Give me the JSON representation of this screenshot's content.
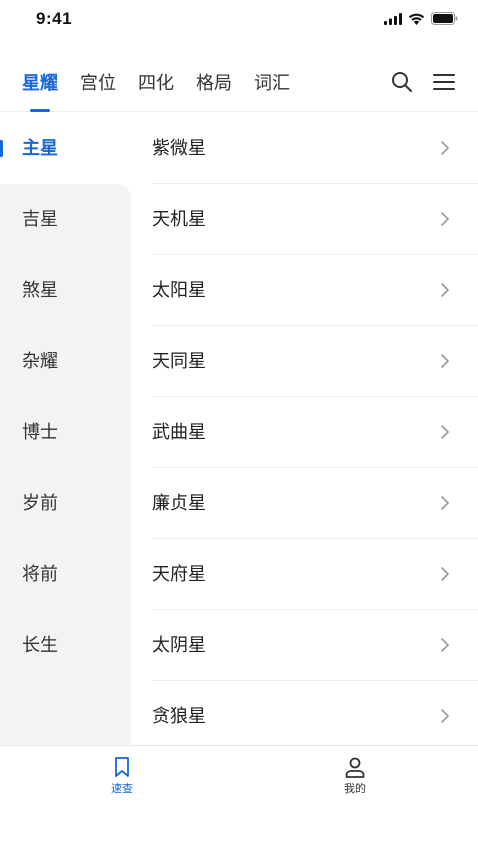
{
  "status_bar": {
    "time": "9:41",
    "icons": [
      "signal-icon",
      "wifi-icon",
      "battery-icon"
    ]
  },
  "top_nav": {
    "tabs": [
      {
        "label": "星耀",
        "active": true
      },
      {
        "label": "宫位",
        "active": false
      },
      {
        "label": "四化",
        "active": false
      },
      {
        "label": "格局",
        "active": false
      },
      {
        "label": "词汇",
        "active": false
      }
    ],
    "icons": [
      "search-icon",
      "menu-icon"
    ]
  },
  "sidebar": {
    "items": [
      {
        "label": "主星",
        "active": true
      },
      {
        "label": "吉星"
      },
      {
        "label": "煞星"
      },
      {
        "label": "杂耀"
      },
      {
        "label": "博士"
      },
      {
        "label": "岁前"
      },
      {
        "label": "将前"
      },
      {
        "label": "长生"
      }
    ]
  },
  "list": {
    "items": [
      {
        "label": "紫微星"
      },
      {
        "label": "天机星"
      },
      {
        "label": "太阳星"
      },
      {
        "label": "天同星"
      },
      {
        "label": "武曲星"
      },
      {
        "label": "廉贞星"
      },
      {
        "label": "天府星"
      },
      {
        "label": "太阴星"
      },
      {
        "label": "贪狼星"
      }
    ]
  },
  "bottom_bar": {
    "tabs": [
      {
        "label": "速查",
        "icon": "bookmark-icon",
        "active": true
      },
      {
        "label": "我的",
        "icon": "user-icon",
        "active": false
      }
    ]
  },
  "colors": {
    "accent": "#1767d8",
    "sidebar_bg": "#f3f3f5"
  }
}
